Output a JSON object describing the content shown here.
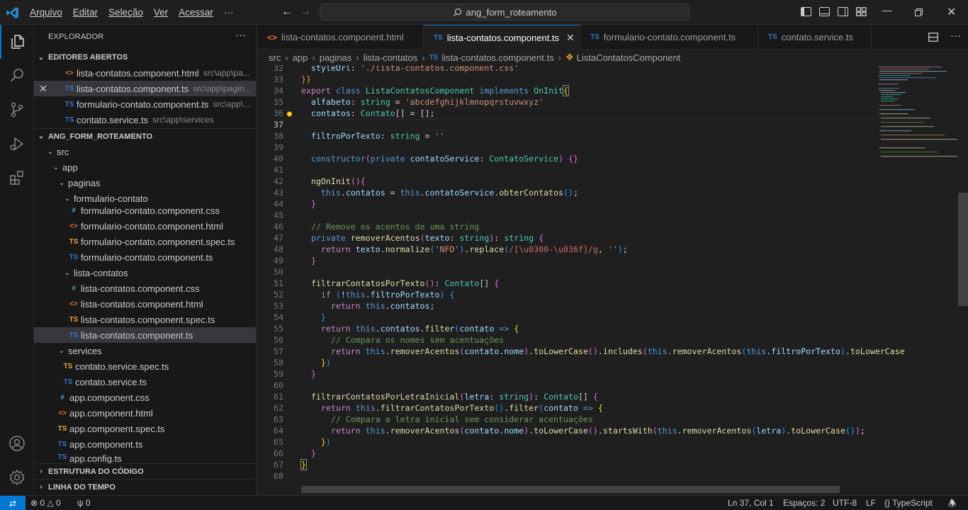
{
  "menu": [
    "Arquivo",
    "Editar",
    "Seleção",
    "Ver",
    "Acessar"
  ],
  "menu_more": "···",
  "search": {
    "text": "ang_form_roteamento"
  },
  "sidebar": {
    "title": "EXPLORADOR",
    "more": "···",
    "open_editors": {
      "header": "EDITORES ABERTOS",
      "items": [
        {
          "icon": "<>",
          "name": "lista-contatos.component.html",
          "desc": "src\\app\\pa..."
        },
        {
          "icon": "TS",
          "name": "lista-contatos.component.ts",
          "desc": "src\\app\\pagin..."
        },
        {
          "icon": "TS",
          "name": "formulario-contato.component.ts",
          "desc": "src\\app\\..."
        },
        {
          "icon": "TS",
          "name": "contato.service.ts",
          "desc": "src\\app\\services"
        }
      ]
    },
    "project": {
      "header": "ANG_FORM_ROTEAMENTO",
      "tree": [
        {
          "label": "src",
          "type": "folder"
        },
        {
          "label": "app",
          "type": "folder"
        },
        {
          "label": "paginas",
          "type": "folder"
        },
        {
          "label": "formulario-contato",
          "type": "folder"
        },
        {
          "label": "formulario-contato.component.css",
          "type": "css",
          "icon": "#"
        },
        {
          "label": "formulario-contato.component.html",
          "type": "html",
          "icon": "<>"
        },
        {
          "label": "formulario-contato.component.spec.ts",
          "type": "spec",
          "icon": "TS"
        },
        {
          "label": "formulario-contato.component.ts",
          "type": "ts",
          "icon": "TS"
        },
        {
          "label": "lista-contatos",
          "type": "folder"
        },
        {
          "label": "lista-contatos.component.css",
          "type": "css",
          "icon": "#"
        },
        {
          "label": "lista-contatos.component.html",
          "type": "html",
          "icon": "<>"
        },
        {
          "label": "lista-contatos.component.spec.ts",
          "type": "spec",
          "icon": "TS"
        },
        {
          "label": "lista-contatos.component.ts",
          "type": "ts",
          "icon": "TS"
        },
        {
          "label": "services",
          "type": "folder"
        },
        {
          "label": "contato.service.spec.ts",
          "type": "spec",
          "icon": "TS"
        },
        {
          "label": "contato.service.ts",
          "type": "ts",
          "icon": "TS"
        },
        {
          "label": "app.component.css",
          "type": "css",
          "icon": "#"
        },
        {
          "label": "app.component.html",
          "type": "html",
          "icon": "<>"
        },
        {
          "label": "app.component.spec.ts",
          "type": "spec",
          "icon": "TS"
        },
        {
          "label": "app.component.ts",
          "type": "ts",
          "icon": "TS"
        },
        {
          "label": "app.config.ts",
          "type": "ts",
          "icon": "TS"
        }
      ]
    },
    "outline_header": "ESTRUTURA DO CÓDIGO",
    "timeline_header": "LINHA DO TEMPO"
  },
  "tabs": [
    {
      "icon": "<>",
      "label": "lista-contatos.component.html"
    },
    {
      "icon": "TS",
      "label": "lista-contatos.component.ts",
      "close": "✕"
    },
    {
      "icon": "TS",
      "label": "formulario-contato.component.ts"
    },
    {
      "icon": "TS",
      "label": "contato.service.ts"
    }
  ],
  "breadcrumb": [
    "src",
    "app",
    "paginas",
    "lista-contatos",
    "lista-contatos.component.ts",
    "ListaContatosComponent"
  ],
  "breadcrumb_ts": "TS",
  "editor": {
    "current_line": 37,
    "line_numbers": [
      32,
      33,
      34,
      35,
      36,
      37,
      38,
      39,
      40,
      41,
      42,
      43,
      44,
      45,
      46,
      47,
      48,
      49,
      50,
      51,
      52,
      53,
      54,
      55,
      56,
      57,
      58,
      59,
      60,
      61,
      62,
      63,
      64,
      65,
      66,
      67,
      68
    ]
  },
  "statusbar": {
    "errors": "0",
    "warnings": "0",
    "ports": "0",
    "position": "Ln 37, Col 1",
    "spaces": "Espaços: 2",
    "encoding": "UTF-8",
    "eol": "LF",
    "language": "TypeScript",
    "language_prefix": "{}"
  },
  "colors": {
    "accent": "#0078d4",
    "background": "#1f1f1f",
    "sidebar": "#181818"
  }
}
